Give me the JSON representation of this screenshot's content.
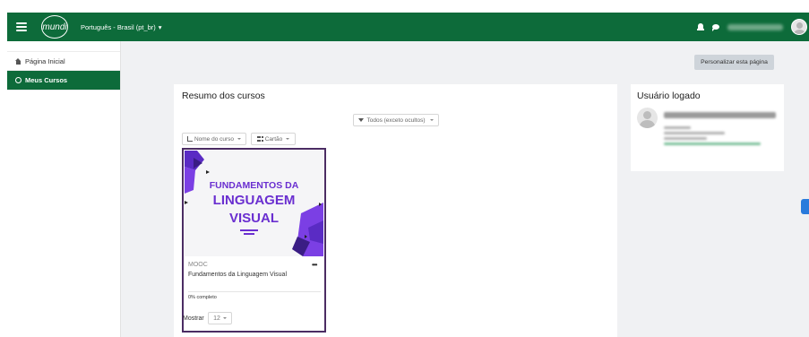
{
  "navbar": {
    "logo_text": "mundi",
    "language": "Português - Brasil (pt_br)",
    "language_caret": "▾",
    "brand_color": "#0d6b3a"
  },
  "drawer": {
    "items": [
      {
        "label": "Página Inicial",
        "icon": "home-icon",
        "active": false
      },
      {
        "label": "Meus Cursos",
        "icon": "dashboard-icon",
        "active": true
      }
    ]
  },
  "page": {
    "customize_button": "Personalizar esta página"
  },
  "course_overview": {
    "title": "Resumo dos cursos",
    "filter": "Todos (exceto ocultos)",
    "sort": "Nome do curso",
    "view": "Cartão",
    "course": {
      "image_lines": [
        "FUNDAMENTOS DA",
        "LINGUAGEM",
        "VISUAL"
      ],
      "category": "MOOC",
      "more": "•••",
      "name": "Fundamentos da Linguagem Visual",
      "progress_text": "0% completo",
      "progress_percent": 0,
      "accent_color": "#6a2fd0"
    },
    "show_label": "Mostrar",
    "show_value": "12"
  },
  "logged_user": {
    "title": "Usuário logado"
  }
}
